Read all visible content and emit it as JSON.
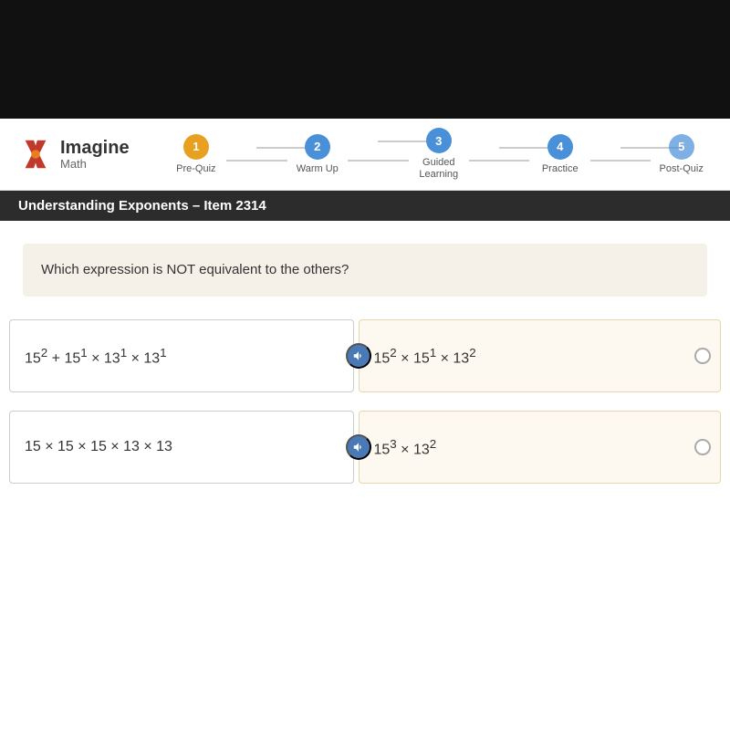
{
  "app": {
    "logo": {
      "imagine": "Imagine",
      "math": "Math"
    },
    "steps": [
      {
        "number": "1",
        "label": "Pre-Quiz",
        "state": "active"
      },
      {
        "number": "2",
        "label": "Warm Up",
        "state": "completed"
      },
      {
        "number": "3",
        "label": "Guided\nLearning",
        "state": "completed"
      },
      {
        "number": "4",
        "label": "Practice",
        "state": "completed"
      },
      {
        "number": "5",
        "label": "Post-Quiz",
        "state": "inactive"
      }
    ],
    "titleBar": "Understanding Exponents – Item 2314",
    "question": "Which expression is NOT equivalent to the others?",
    "answers": [
      {
        "id": "A",
        "left": true,
        "mathText": "15² + 15¹ × 13¹ × 13¹",
        "audio": true
      },
      {
        "id": "B",
        "left": false,
        "mathText": "15² × 15¹ × 13²",
        "radio": true
      },
      {
        "id": "C",
        "left": true,
        "mathText": "15 × 15 × 15 × 13 × 13",
        "audio": true
      },
      {
        "id": "D",
        "left": false,
        "mathText": "15³ × 13²",
        "radio": true
      }
    ]
  }
}
